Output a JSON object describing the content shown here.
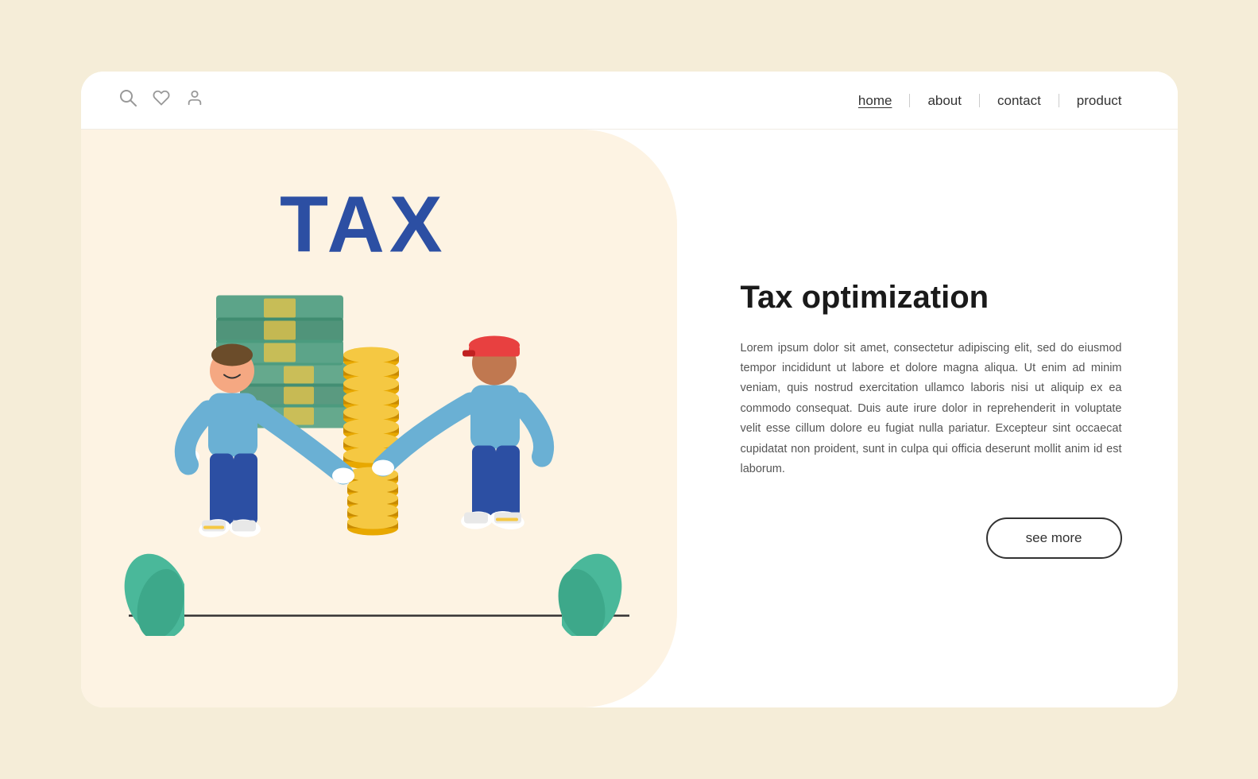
{
  "navbar": {
    "links": [
      {
        "id": "home",
        "label": "home",
        "active": true
      },
      {
        "id": "about",
        "label": "about",
        "active": false
      },
      {
        "id": "contact",
        "label": "contact",
        "active": false
      },
      {
        "id": "product",
        "label": "product",
        "active": false
      }
    ],
    "icons": [
      {
        "id": "search",
        "symbol": "🔍",
        "name": "search-icon"
      },
      {
        "id": "heart",
        "symbol": "♡",
        "name": "heart-icon"
      },
      {
        "id": "user",
        "symbol": "👤",
        "name": "user-icon"
      }
    ]
  },
  "hero": {
    "tax_label": "TAX",
    "title": "Tax optimization",
    "body": "Lorem ipsum dolor sit amet, consectetur adipiscing elit, sed do eiusmod tempor incididunt ut labore et dolore magna aliqua. Ut enim ad minim veniam, quis nostrud exercitation ullamco laboris nisi ut aliquip ex ea commodo consequat. Duis aute irure dolor in reprehenderit in voluptate velit esse cillum dolore eu fugiat nulla pariatur. Excepteur sint occaecat cupidatat non proident, sunt in culpa qui officia deserunt mollit anim id est laborum.",
    "cta_label": "see more"
  },
  "colors": {
    "bg_outer": "#f5edd8",
    "bg_illustration": "#fdf3e3",
    "tax_blue": "#2c4fa3",
    "coin_gold": "#f5c842",
    "bill_green": "#4a9b7e",
    "leaf_green": "#4ab89a",
    "figure_shirt": "#6ab0d4",
    "figure_pants": "#2c4fa3",
    "accent_border": "#333333"
  }
}
